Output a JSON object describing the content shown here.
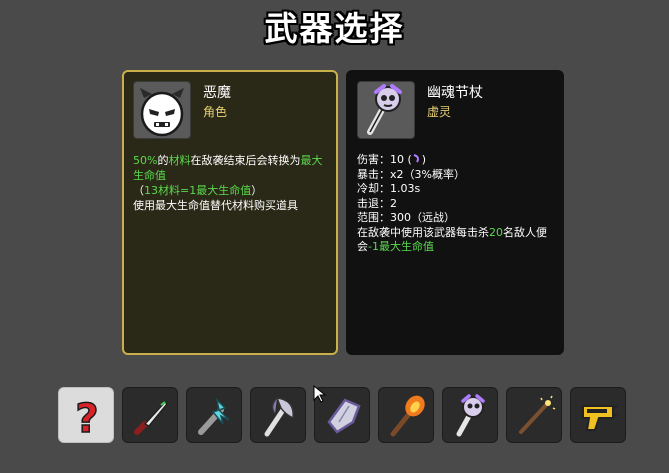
{
  "title": "武器选择",
  "character": {
    "name": "恶魔",
    "type": "角色",
    "desc": {
      "l1_pct": "50%",
      "l1_de": "的",
      "l1_mat": "材料",
      "l1_txt": "在敌袭结束后会转换为",
      "l1_max": "最大生命值",
      "l2_open": "（",
      "l2_thirteen": "13材料=1最大生命值",
      "l2_close": "）",
      "l3": "使用最大生命值替代材料购买道具"
    }
  },
  "weapon": {
    "name": "幽魂节杖",
    "type": "虚灵",
    "damage_label": "伤害：",
    "damage_value": "10 (",
    "damage_close": ")",
    "crit_label": "暴击：",
    "crit_value": "x2（3%概率）",
    "cooldown_label": "冷却：",
    "cooldown_value": "1.03s",
    "knockback_label": "击退：",
    "knockback_value": "2",
    "range_label": "范围：",
    "range_value": "300（远战）",
    "effect_a": "在敌袭中使用该武器每击杀",
    "effect_num": "20",
    "effect_b": "名敌人便会",
    "effect_c": "-1最大生命值"
  },
  "slots": [
    {
      "icon": "random-question-icon",
      "selected": true
    },
    {
      "icon": "knife-icon",
      "selected": false
    },
    {
      "icon": "lightning-wand-icon",
      "selected": false
    },
    {
      "icon": "axe-icon",
      "selected": false
    },
    {
      "icon": "crystal-shard-icon",
      "selected": false
    },
    {
      "icon": "torch-icon",
      "selected": false
    },
    {
      "icon": "ghost-scepter-icon",
      "selected": false
    },
    {
      "icon": "magic-wand-icon",
      "selected": false
    },
    {
      "icon": "taser-icon",
      "selected": false
    }
  ],
  "colors": {
    "highlight_green": "#5bd94e",
    "accent_purple": "#b07cff",
    "character_border": "#c9b04a"
  }
}
